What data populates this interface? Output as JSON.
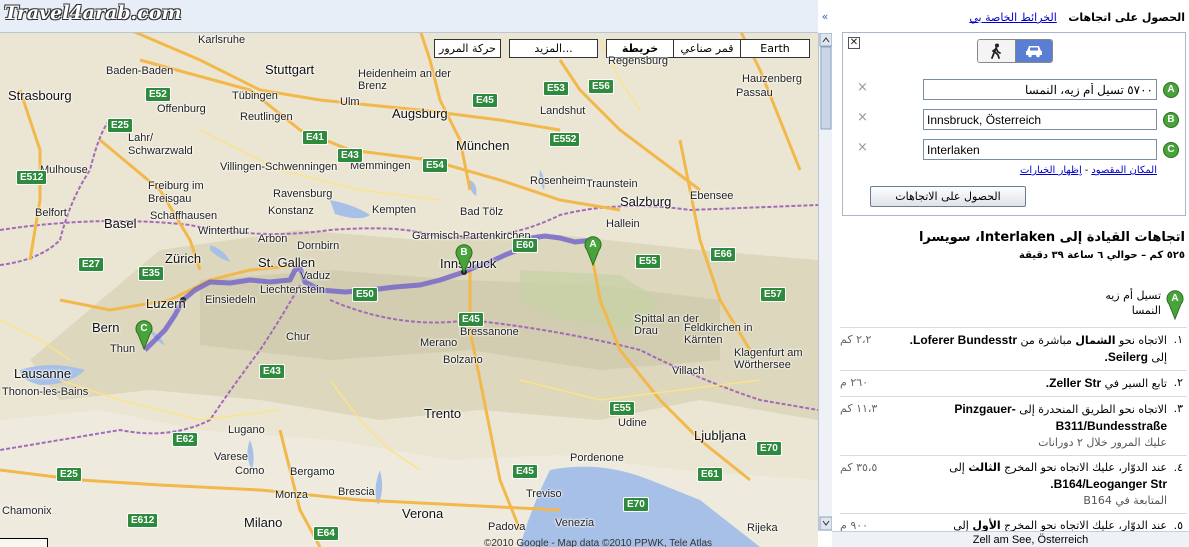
{
  "map": {
    "watermark": "Travel4arab.com",
    "buttons": {
      "traffic": "حركة المرور",
      "more": "المزيد...",
      "map": "خريطة",
      "satellite": "قمر صناعي",
      "earth": "Earth"
    },
    "copyright": "©2010 Google - Map data ©2010 PPWK, Tele Atlas",
    "cities": {
      "karlsruhe": "Karlsruhe",
      "stuttgart": "Stuttgart",
      "heidenheim": "Heidenheim an der Brenz",
      "regensburg": "Regensburg",
      "baden_baden": "Baden-Baden",
      "strasbourg": "Strasbourg",
      "offenburg": "Offenburg",
      "tubingen": "Tübingen",
      "reutlingen": "Reutlingen",
      "ulm": "Ulm",
      "augsburg": "Augsburg",
      "landshut": "Landshut",
      "hauzenberg": "Hauzenberg",
      "passau": "Passau",
      "lahr": "Lahr/ Schwarzwald",
      "villingen": "Villingen-Schwenningen",
      "munchen": "München",
      "mulhouse": "Mulhouse",
      "freiburg": "Freiburg im Breisgau",
      "ravensburg": "Ravensburg",
      "memmingen": "Memmingen",
      "rosenheim": "Rosenheim",
      "belfort": "Belfort",
      "basel": "Basel",
      "schaffhausen": "Schaffhausen",
      "konstanz": "Konstanz",
      "kempten": "Kempten",
      "bad_tolz": "Bad Tölz",
      "traunstein": "Traunstein",
      "ebensee": "Ebensee",
      "salzburg": "Salzburg",
      "garmisch": "Garmisch-Partenkirchen",
      "hallein": "Hallein",
      "winterthur": "Winterthur",
      "arbon": "Arbon",
      "dornbirn": "Dornbirn",
      "zurich": "Zürich",
      "st_gallen": "St. Gallen",
      "innsbruck": "Innsbruck",
      "vaduz": "Vaduz",
      "liechtenstein": "Liechtenstein",
      "einsiedeln": "Einsiedeln",
      "lucerne": "Luzern",
      "bern": "Bern",
      "thun": "Thun",
      "chur": "Chur",
      "lausanne": "Lausanne",
      "bressanone": "Bressanone",
      "spittal": "Spittal an der Drau",
      "feldkirchen": "Feldkirchen in Kärnten",
      "klagenfurt": "Klagenfurt am Wörthersee",
      "bolzano": "Bolzano",
      "merano": "Merano",
      "villach": "Villach",
      "thonon": "Thonon-les-Bains",
      "trento": "Trento",
      "lugano": "Lugano",
      "como": "Como",
      "udine": "Udine",
      "ljubljana": "Ljubljana",
      "varese": "Varese",
      "bergamo": "Bergamo",
      "brescia": "Brescia",
      "verona": "Verona",
      "treviso": "Treviso",
      "monza": "Monza",
      "milano": "Milano",
      "padova": "Padova",
      "venezia": "Venezia",
      "rijeka": "Rijeka",
      "chamonix": "Chamonix",
      "pordenone": "Pordenone"
    },
    "roads": [
      "E52",
      "E41",
      "E54",
      "E43",
      "E45",
      "E53",
      "E56",
      "E552",
      "E25",
      "E512",
      "E60",
      "E35",
      "E27",
      "E62",
      "E43",
      "E45",
      "E55",
      "E66",
      "E57",
      "E61",
      "E70",
      "E70",
      "E612",
      "E25",
      "E64",
      "E55",
      "E45",
      "E50"
    ],
    "markers": [
      "A",
      "B",
      "C"
    ]
  },
  "panel": {
    "tab_active": "الحصول على اتجاهات",
    "tab_link": "الخرائط الخاصة بي",
    "modes": {
      "walk": "walking-icon",
      "car": "car-icon"
    },
    "destinations": [
      {
        "letter": "A",
        "value": "٥٧٠٠ تسيل أم زيه، النمسا"
      },
      {
        "letter": "B",
        "value": "Innsbruck, Österreich"
      },
      {
        "letter": "C",
        "value": "Interlaken"
      }
    ],
    "link_destination": "المكان المقصود",
    "link_options": "إظهار الخيارات",
    "get_directions_button": "الحصول على الاتجاهات",
    "title": "اتجاهات القيادة إلى Interlaken، سويسرا",
    "summary": "٥٢٥ كم – حوالي ٦ ساعة ٣٩ دقيقة",
    "start_line1": "تسيل أم زيه",
    "start_line2": "النمسا",
    "steps": [
      {
        "num": "١.",
        "text_a": "الاتجاه نحو ",
        "text_bold1": "الشمال",
        "text_b": " مباشرة من ",
        "road1": "Loferer Bundesstr.",
        "text_c": "إلى ",
        "road2": "Seilerg.",
        "note": "",
        "dist": "٢،٢ كم"
      },
      {
        "num": "٢.",
        "text_a": "تابع السير في ",
        "text_bold1": "",
        "text_b": "",
        "road1": "Zeller Str.",
        "text_c": "",
        "road2": "",
        "note": "",
        "dist": "٢٦٠ م"
      },
      {
        "num": "٣.",
        "text_a": "الاتجاه نحو الطريق المنحدرة إلى ",
        "text_bold1": "",
        "text_b": "",
        "road1": "-Pinzgauer",
        "text_c": "",
        "road2": "B311/Bundesstraße",
        "note": "عليك المرور خلال ٢ دورانات",
        "dist": "١١،٣ كم"
      },
      {
        "num": "٤.",
        "text_a": "عند الدوّار، عليك الاتجاه نحو المخرج ",
        "text_bold1": "الثالث",
        "text_b": " إلى",
        "road1": "",
        "text_c": "",
        "road2": "B164/Leoganger Str.",
        "note": "المتابعة في B164",
        "dist": "٣٥،٥ كم"
      },
      {
        "num": "٥.",
        "text_a": "عند الدوّار، عليك الاتجاه نحو المخرج ",
        "text_bold1": "الأول",
        "text_b": " إلى",
        "road1": "",
        "text_c": "",
        "road2": "",
        "note": "",
        "dist": "٩٠٠ م"
      }
    ],
    "status": "Zell am See, Österreich"
  },
  "colors": {
    "route": "#6a5acd",
    "marker_green": "#49a33b",
    "road_green": "#2e8b3e",
    "link": "#0000cc"
  }
}
